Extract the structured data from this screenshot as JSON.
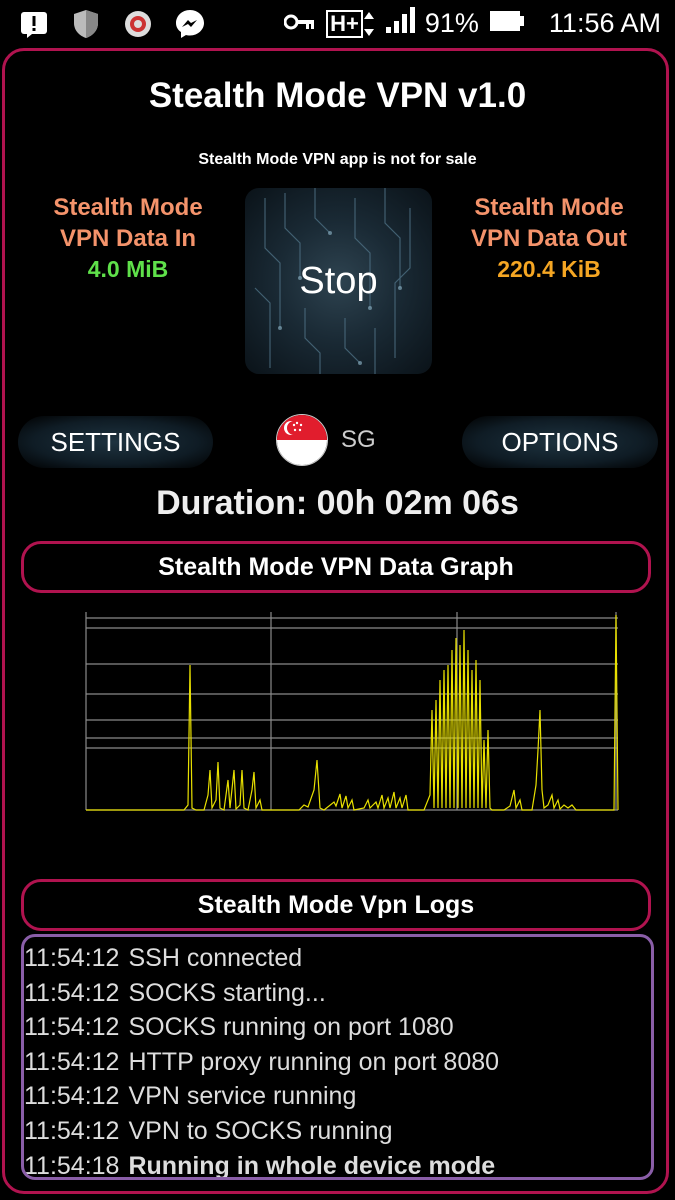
{
  "statusbar": {
    "icons": [
      "alert-icon",
      "shield-icon",
      "app-icon",
      "messenger-icon"
    ],
    "right_icons": [
      "key-icon",
      "network-hplus-icon",
      "signal-icon",
      "battery-icon"
    ],
    "network": "H+",
    "battery": "91%",
    "time": "11:56 AM"
  },
  "app": {
    "title": "Stealth Mode VPN v1.0",
    "subtitle": "Stealth Mode VPN app is not for sale"
  },
  "data_in": {
    "label_line1": "Stealth Mode",
    "label_line2": "VPN Data In",
    "value": "4.0 MiB",
    "color": "#5fe04a"
  },
  "data_out": {
    "label_line1": "Stealth Mode",
    "label_line2": "VPN Data Out",
    "value": "220.4 KiB",
    "color": "#f5a623"
  },
  "stop_button": {
    "label": "Stop"
  },
  "settings_button": {
    "label": "SETTINGS"
  },
  "options_button": {
    "label": "OPTIONS"
  },
  "server": {
    "country_code": "SG",
    "flag": "singapore-flag-icon"
  },
  "duration": "Duration: 00h 02m 06s",
  "graph_section": {
    "title": "Stealth Mode VPN Data Graph"
  },
  "logs_section": {
    "title": "Stealth Mode Vpn Logs"
  },
  "logs": [
    {
      "time": "11:54:12",
      "message": "SSH connected",
      "bold": false
    },
    {
      "time": "11:54:12",
      "message": "SOCKS starting...",
      "bold": false
    },
    {
      "time": "11:54:12",
      "message": "SOCKS running on port 1080",
      "bold": false
    },
    {
      "time": "11:54:12",
      "message": "HTTP proxy running on port 8080",
      "bold": false
    },
    {
      "time": "11:54:12",
      "message": "VPN service running",
      "bold": false
    },
    {
      "time": "11:54:12",
      "message": "VPN to SOCKS running",
      "bold": false
    },
    {
      "time": "11:54:18",
      "message": "Running in whole device mode",
      "bold": true
    }
  ],
  "colors": {
    "accent_border": "#b0134f",
    "log_border": "#8a5ea8",
    "graph_line": "#e8e000",
    "label": "#f4936b"
  }
}
